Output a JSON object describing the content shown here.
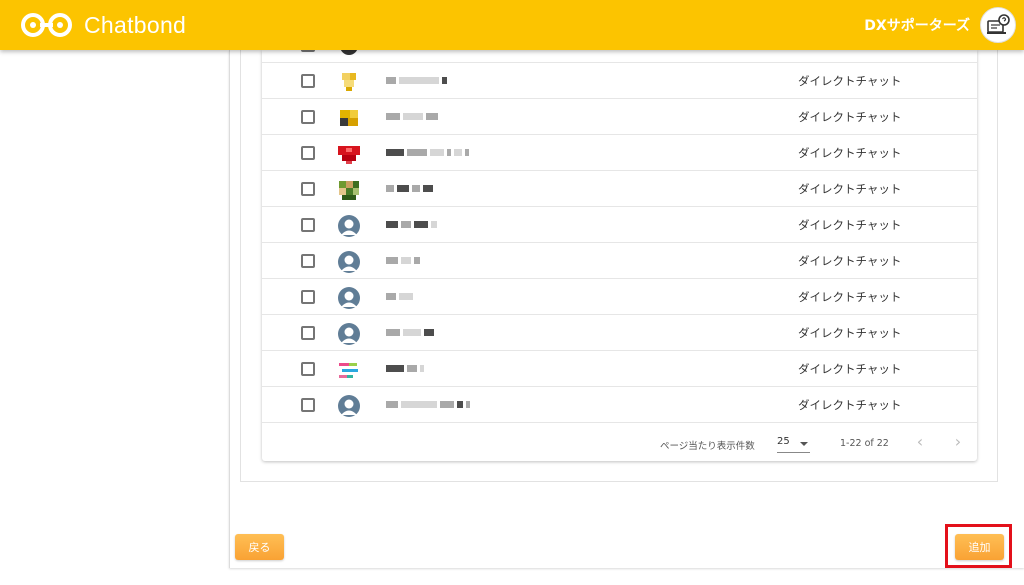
{
  "header": {
    "app_name": "Chatbond",
    "user_name": "DXサポーターズ",
    "brand_color": "#fcc400",
    "logo_icon": "chain-link-logo-icon",
    "avatar_icon": "support-avatar-icon"
  },
  "table": {
    "rows": [
      {
        "type": "ダイレクトチャット",
        "avatar": "pixel-avatar-yellow"
      },
      {
        "type": "ダイレクトチャット",
        "avatar": "pixel-avatar-yellow-dark"
      },
      {
        "type": "ダイレクトチャット",
        "avatar": "pixel-avatar-red"
      },
      {
        "type": "ダイレクトチャット",
        "avatar": "pixel-avatar-green"
      },
      {
        "type": "ダイレクトチャット",
        "avatar": "default-user-icon"
      },
      {
        "type": "ダイレクトチャット",
        "avatar": "default-user-icon"
      },
      {
        "type": "ダイレクトチャット",
        "avatar": "default-user-icon"
      },
      {
        "type": "ダイレクトチャット",
        "avatar": "default-user-icon"
      },
      {
        "type": "ダイレクトチャット",
        "avatar": "colorful-lines-avatar"
      },
      {
        "type": "ダイレクトチャット",
        "avatar": "default-user-icon"
      }
    ]
  },
  "pagination": {
    "per_page_label": "ページ当たり表示件数",
    "per_page_value": "25",
    "range": "1-22 of 22",
    "prev_icon": "chevron-left-icon",
    "next_icon": "chevron-right-icon"
  },
  "actions": {
    "back_label": "戻る",
    "add_label": "追加",
    "button_color": "#f9a234",
    "highlight_color": "#e3101a"
  }
}
